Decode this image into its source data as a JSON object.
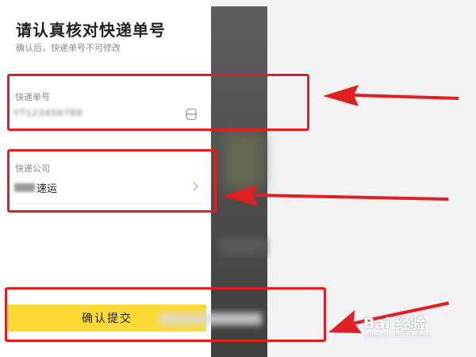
{
  "dialog": {
    "title": "请认真核对快递单号",
    "subtitle": "确认后，快递单号不可修改"
  },
  "tracking": {
    "label": "快递单号",
    "value": "YT123456789"
  },
  "company": {
    "label": "快递公司",
    "value": "速运"
  },
  "submit": {
    "label": "确认提交"
  },
  "watermark": {
    "main": "Bai 经验",
    "sub": "jingyan.baidu.com"
  },
  "colors": {
    "accent_yellow": "#fcd934",
    "annotation_red": "#e02020"
  },
  "icons": {
    "scan": "scan-icon",
    "chevron": "chevron-right-icon",
    "paw": "paw-icon"
  }
}
